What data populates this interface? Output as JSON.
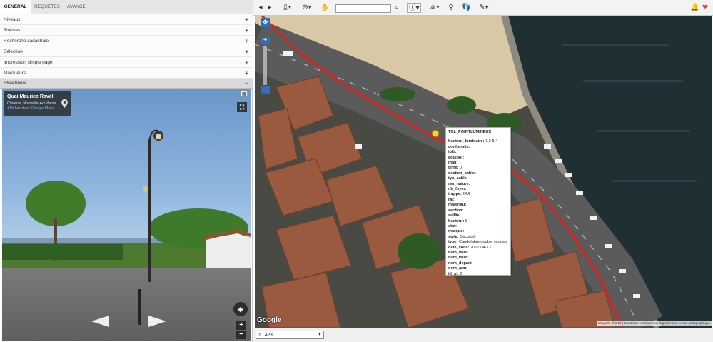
{
  "sidebar": {
    "tabs": [
      {
        "label": "GÉNÉRAL",
        "active": true
      },
      {
        "label": "REQUÊTES",
        "active": false
      },
      {
        "label": "AVANCÉ",
        "active": false
      }
    ],
    "accordion": [
      {
        "label": "Niveaux"
      },
      {
        "label": "Thèmes"
      },
      {
        "label": "Recherche cadastrale"
      },
      {
        "label": "Sélection"
      },
      {
        "label": "Impression simple page"
      },
      {
        "label": "Marqueurs"
      }
    ],
    "expand_symbol": "+",
    "collapse_symbol": "−",
    "streetview_header": "StreetView"
  },
  "streetview": {
    "place_title": "Quai Maurice Ravel",
    "place_subtitle": "Ciboure, Nouvelle-Aquitaine",
    "maps_link": "Afficher dans Google Maps",
    "zoom_in": "+",
    "zoom_out": "−"
  },
  "map": {
    "google_logo": "Google",
    "attribution": "Imagerie ©2017  |  Conditions d'utilisation  |  Signaler une erreur cartographique",
    "scale_value": "1 : 423",
    "zoom_plus": "+",
    "zoom_minus": "−"
  },
  "popup": {
    "title": "TCL_POINTLUMINEUX",
    "rows": [
      {
        "key": "hauteur_luminaire:",
        "value": "7.2-5.4"
      },
      {
        "key": "conformite:",
        "value": ""
      },
      {
        "key": "ip2c:",
        "value": ""
      },
      {
        "key": "equipot:",
        "value": ""
      },
      {
        "key": "malt:",
        "value": ""
      },
      {
        "key": "terre:",
        "value": "0"
      },
      {
        "key": "section_cable:",
        "value": ""
      },
      {
        "key": "typ_cable:",
        "value": ""
      },
      {
        "key": "res_nature:",
        "value": ""
      },
      {
        "key": "nb_foyer:",
        "value": ""
      },
      {
        "key": "trappe:",
        "value": "OUI"
      },
      {
        "key": "ral:",
        "value": ""
      },
      {
        "key": "materiau:",
        "value": ""
      },
      {
        "key": "section:",
        "value": ""
      },
      {
        "key": "saillie:",
        "value": ""
      },
      {
        "key": "hauteur:",
        "value": "8"
      },
      {
        "key": "etat:",
        "value": ""
      },
      {
        "key": "marque:",
        "value": ""
      },
      {
        "key": "style:",
        "value": "Decoratif"
      },
      {
        "key": "type:",
        "value": "Candelabre double crosses"
      },
      {
        "key": "date_cons:",
        "value": "2017-04-13"
      },
      {
        "key": "nom_voie:",
        "value": ""
      },
      {
        "key": "num_voie:",
        "value": ""
      },
      {
        "key": "num_depart:",
        "value": ""
      },
      {
        "key": "nom_arm:",
        "value": ""
      },
      {
        "key": "id_pl:",
        "value": "0"
      }
    ]
  },
  "colors": {
    "route_line": "#e0201a",
    "accent": "#1a73e8"
  }
}
